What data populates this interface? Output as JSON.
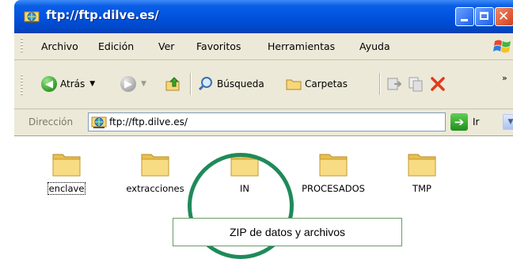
{
  "window": {
    "title": "ftp://ftp.dilve.es/"
  },
  "menu": {
    "items": [
      "Archivo",
      "Edición",
      "Ver",
      "Favoritos",
      "Herramientas",
      "Ayuda"
    ]
  },
  "toolbar": {
    "back_label": "Atrás",
    "search_label": "Búsqueda",
    "folders_label": "Carpetas",
    "overflow": "»"
  },
  "address": {
    "label": "Dirección",
    "value": "ftp://ftp.dilve.es/",
    "go_label": "Ir"
  },
  "folders": [
    {
      "name": "enclave",
      "focused": true
    },
    {
      "name": "extracciones",
      "focused": false
    },
    {
      "name": "IN",
      "focused": false
    },
    {
      "name": "PROCESADOS",
      "focused": false
    },
    {
      "name": "TMP",
      "focused": false
    }
  ],
  "annotation": {
    "caption": "ZIP de datos y archivos",
    "ring_color": "#1f8a5a"
  },
  "colors": {
    "titlebar": "#0051dd",
    "chrome": "#ece9d8",
    "folder": "#f6d77a"
  }
}
